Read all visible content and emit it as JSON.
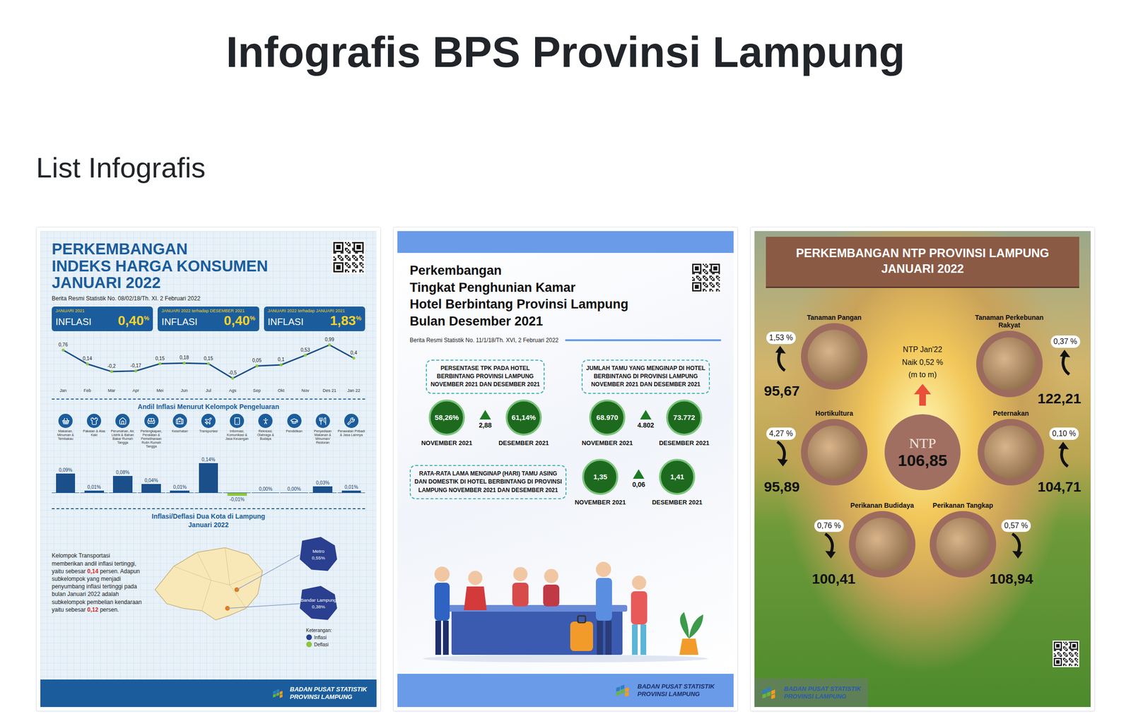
{
  "page": {
    "title": "Infografis BPS Provinsi Lampung",
    "section": "List Infografis"
  },
  "infographics": [
    {
      "kind": "ihk",
      "title": [
        "PERKEMBANGAN",
        "INDEKS HARGA KONSUMEN",
        "JANUARI 2022"
      ],
      "release": "Berita Resmi Statistik No. 08/02/18/Th. XI. 2 Februari 2022",
      "stats": [
        {
          "period": "JANUARI 2021",
          "label": "INFLASI",
          "value": "0,40",
          "unit": "%"
        },
        {
          "period": "JANUARI 2022 terhadap DESEMBER 2021",
          "label": "INFLASI",
          "value": "0,40",
          "unit": "%"
        },
        {
          "period": "JANUARI 2022 terhadap JANUARI 2021",
          "label": "INFLASI",
          "value": "1,83",
          "unit": "%"
        }
      ],
      "trend": {
        "months": [
          "Jan",
          "Feb",
          "Mar",
          "Apr",
          "Mei",
          "Jun",
          "Jul",
          "Ags",
          "Sep",
          "Okt",
          "Nov",
          "Des 21",
          "Jan 22"
        ],
        "values": [
          0.76,
          0.14,
          -0.2,
          -0.17,
          0.15,
          0.18,
          0.15,
          -0.5,
          0.05,
          0.1,
          0.53,
          0.99,
          0.4
        ],
        "labels": [
          "0,76",
          "0,14",
          "-0,2",
          "-0,17",
          "0,15",
          "0,18",
          "0,15",
          "-0,5",
          "0,05",
          "0,1",
          "0,53",
          "0,99",
          "0,4"
        ]
      },
      "contribution": {
        "title": "Andil Inflasi Menurut Kelompok Pengeluaran",
        "groups": [
          {
            "name": "Makanan, Minuman & Tembakau",
            "value": 0.09,
            "label": "0,09%"
          },
          {
            "name": "Pakaian & Alas Kaki",
            "value": 0.01,
            "label": "0,01%"
          },
          {
            "name": "Perumahan, Air, Listrik & Bahan Bakar Rumah Tangga",
            "value": 0.08,
            "label": "0,08%"
          },
          {
            "name": "Perlengkapan, Peralatan & Pemeliharaan Rutin Rumah Tangga",
            "value": 0.04,
            "label": "0,04%"
          },
          {
            "name": "Kesehatan",
            "value": 0.01,
            "label": "0,01%"
          },
          {
            "name": "Transportasi",
            "value": 0.14,
            "label": "0,14%"
          },
          {
            "name": "Informasi, Komunikasi & Jasa Keuangan",
            "value": -0.01,
            "label": "-0,01%"
          },
          {
            "name": "Rekreasi, Olahraga & Budaya",
            "value": 0.0,
            "label": "0,00%"
          },
          {
            "name": "Pendidikan",
            "value": 0.0,
            "label": "0,00%"
          },
          {
            "name": "Penyediaan Makanan & Minuman/ Restoran",
            "value": 0.03,
            "label": "0,03%"
          },
          {
            "name": "Perawatan Pribadi & Jasa Lainnya",
            "value": 0.01,
            "label": "0,01%"
          }
        ]
      },
      "cities": {
        "title": [
          "Inflasi/Deflasi Dua Kota di Lampung",
          "Januari 2022"
        ],
        "note": [
          {
            "text": "Kelompok Transportasi memberikan andil inflasi tertinggi, yaitu sebesar ",
            "highlight": false
          },
          {
            "text": "0,14",
            "highlight": true
          },
          {
            "text": " persen. Adapun subkelompok yang menjadi penyumbang inflasi tertinggi pada bulan Januari 2022 adalah subkelompok pembelian kendaraan yaitu sebesar ",
            "highlight": false
          },
          {
            "text": "0,12",
            "highlight": true
          },
          {
            "text": " persen.",
            "highlight": false
          }
        ],
        "pins": [
          {
            "name": "Metro",
            "value": "0,55%",
            "color": "#2a3f8f"
          },
          {
            "name": "Bandar Lampung",
            "value": "0,38%",
            "color": "#2a3f8f"
          }
        ],
        "legendTitle": "Keterangan:",
        "legend": [
          {
            "label": "Inflasi",
            "color": "#2a3f8f"
          },
          {
            "label": "Deflasi",
            "color": "#8dc63f"
          }
        ]
      },
      "footer": [
        "BADAN PUSAT STATISTIK",
        "PROVINSI LAMPUNG"
      ]
    },
    {
      "kind": "hotel",
      "title": [
        "Perkembangan",
        "Tingkat Penghunian Kamar",
        "Hotel Berbintang Provinsi Lampung",
        "Bulan Desember 2021"
      ],
      "release": "Berita Resmi Statistik No. 11/1/18/Th. XVI, 2 Februari 2022",
      "stats": [
        {
          "kind": "stacked",
          "title": [
            "PERSENTASE TPK PADA HOTEL",
            "BERBINTANG PROVINSI LAMPUNG",
            "NOVEMBER 2021 DAN DESEMBER 2021"
          ],
          "before": {
            "value": "58,26%",
            "period": "NOVEMBER 2021"
          },
          "delta": "2,88",
          "after": {
            "value": "61,14%",
            "period": "DESEMBER 2021"
          }
        },
        {
          "kind": "stacked",
          "title": [
            "JUMLAH TAMU YANG MENGINAP DI HOTEL",
            "BERBINTANG DI PROVINSI LAMPUNG",
            "NOVEMBER 2021 DAN DESEMBER 2021"
          ],
          "before": {
            "value": "68.970",
            "period": "NOVEMBER 2021"
          },
          "delta": "4.802",
          "after": {
            "value": "73.772",
            "period": "DESEMBER 2021"
          }
        },
        {
          "kind": "side",
          "title": [
            "RATA-RATA LAMA MENGINAP (HARI) TAMU ASING",
            "DAN DOMESTIK DI HOTEL BERBINTANG DI PROVINSI",
            "LAMPUNG NOVEMBER 2021 DAN DESEMBER 2021"
          ],
          "before": {
            "value": "1,35",
            "period": "NOVEMBER 2021"
          },
          "delta": "0,06",
          "after": {
            "value": "1,41",
            "period": "DESEMBER 2021"
          }
        }
      ],
      "footer": [
        "BADAN PUSAT STATISTIK",
        "PROVINSI LAMPUNG"
      ]
    },
    {
      "kind": "ntp",
      "title": [
        "PERKEMBANGAN NTP PROVINSI LAMPUNG",
        "JANUARI 2022"
      ],
      "summary": [
        "NTP Jan'22",
        "Naik 0,52 %",
        "(m to m)"
      ],
      "ntp": {
        "label": "NTP",
        "value": "106,85"
      },
      "sectors": [
        {
          "name": "Tanaman Pangan",
          "change": "1,53 %",
          "trend": "up",
          "value": "95,67"
        },
        {
          "name": "Tanaman Perkebunan Rakyat",
          "change": "0,37 %",
          "trend": "up",
          "value": "122,21"
        },
        {
          "name": "Hortikultura",
          "change": "4,27 %",
          "trend": "down",
          "value": "95,89"
        },
        {
          "name": "Peternakan",
          "change": "0,10 %",
          "trend": "up",
          "value": "104,71"
        },
        {
          "name": "Perikanan Budidaya",
          "change": "0,76 %",
          "trend": "down",
          "value": "100,41"
        },
        {
          "name": "Perikanan Tangkap",
          "change": "0,57 %",
          "trend": "down",
          "value": "108,94"
        }
      ],
      "footer": [
        "BADAN PUSAT STATISTIK",
        "PROVINSI LAMPUNG"
      ]
    }
  ]
}
